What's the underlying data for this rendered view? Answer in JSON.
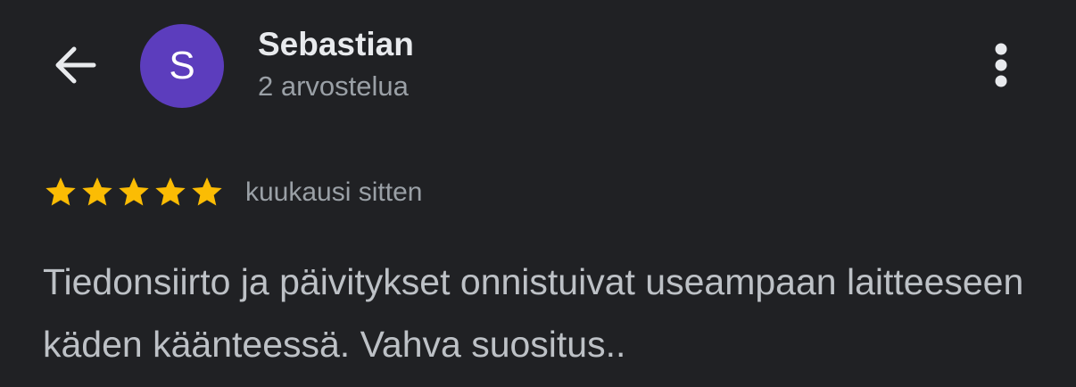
{
  "header": {
    "back_icon": "arrow-left-icon",
    "avatar_letter": "S",
    "avatar_color": "#5c3dbd",
    "author_name": "Sebastian",
    "review_count": "2 arvostelua",
    "menu_icon": "more-vertical-icon"
  },
  "review": {
    "rating": 5,
    "max_rating": 5,
    "star_color": "#fbbc04",
    "time": "kuukausi sitten",
    "text": "Tiedonsiirto ja päivitykset onnistuivat useampaan laitteeseen käden käänteessä. Vahva suositus.."
  }
}
